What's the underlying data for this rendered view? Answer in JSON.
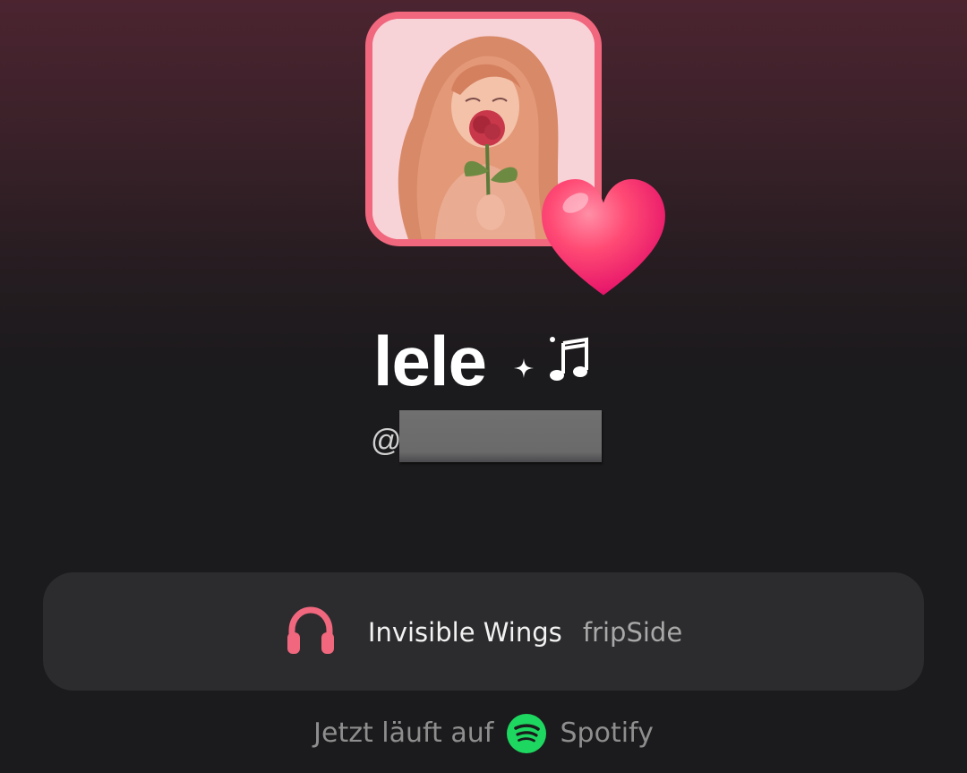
{
  "profile": {
    "display_name": "lele",
    "handle_prefix": "@",
    "handle_redacted": true
  },
  "now_playing": {
    "song_title": "Invisible Wings",
    "artist": "fripSide",
    "source_prefix": "Jetzt läuft auf",
    "source_name": "Spotify"
  },
  "icons": {
    "avatar": "avatar-illustration",
    "heart": "heart-icon",
    "sparkle": "sparkle-icon",
    "music_note": "music-note-icon",
    "headphones": "headphones-icon",
    "spotify": "spotify-icon"
  },
  "colors": {
    "accent": "#f0677e",
    "heart": "#ff3d72",
    "spotify": "#1ed760",
    "card_background": "#2c2c2e",
    "background": "#1b1a1c"
  }
}
